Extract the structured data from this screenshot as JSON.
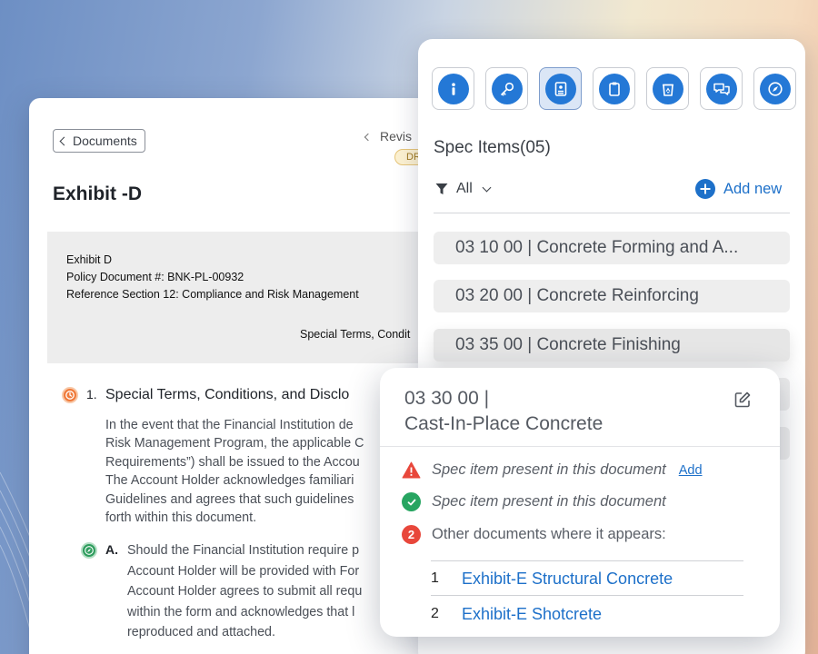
{
  "document": {
    "back_label": "Documents",
    "revision_label": "Revis",
    "draft_badge": "DR",
    "title": "Exhibit -D",
    "header_lines": [
      "Exhibit D",
      "Policy Document #: BNK-PL-00932",
      "Reference Section 12: Compliance and Risk Management"
    ],
    "header_center": "Special Terms, Condit",
    "section1": {
      "number": "1.",
      "heading": "Special Terms, Conditions, and Disclo",
      "body": [
        "In the event that the Financial Institution de",
        "Risk Management Program, the applicable C",
        "Requirements”) shall be issued to the Accou",
        "The Account Holder acknowledges familiari",
        "Guidelines and agrees that such guidelines",
        "forth within this document."
      ]
    },
    "sectionA": {
      "number": "A.",
      "body": [
        "Should the Financial Institution require p",
        "Account Holder will be provided with For",
        "Account Holder agrees to submit all requ",
        "within the form and acknowledges that l",
        "reproduced and attached."
      ]
    }
  },
  "spec_panel": {
    "tools": [
      {
        "name": "info-icon",
        "active": false
      },
      {
        "name": "key-icon",
        "active": false
      },
      {
        "name": "document-id-icon",
        "active": true
      },
      {
        "name": "clipboard-icon",
        "active": false
      },
      {
        "name": "recycle-bin-icon",
        "active": false
      },
      {
        "name": "chat-bubbles-icon",
        "active": false
      },
      {
        "name": "compass-icon",
        "active": false
      }
    ],
    "title": "Spec Items(05)",
    "filter_label": "All",
    "add_new_label": "Add new",
    "items": [
      "03 10 00 | Concrete Forming and A...",
      "03 20 00 | Concrete Reinforcing",
      "03 35 00 | Concrete Finishing"
    ]
  },
  "popover": {
    "code": "03 30 00 |",
    "name": "Cast-In-Place Concrete",
    "warning_text": "Spec item present in this document",
    "warning_add_label": "Add",
    "ok_text": "Spec item present in this document",
    "other_count": "2",
    "other_label": "Other documents where it appears:",
    "documents": [
      {
        "num": "1",
        "label": "Exhibit-E Structural Concrete"
      },
      {
        "num": "2",
        "label": "Exhibit-E Shotcrete"
      }
    ]
  },
  "colors": {
    "accent_blue": "#1d70c9",
    "icon_blue": "#2478d6",
    "warning_red": "#e8473b",
    "success_green": "#27a561",
    "section_orange": "#f07a3a"
  }
}
